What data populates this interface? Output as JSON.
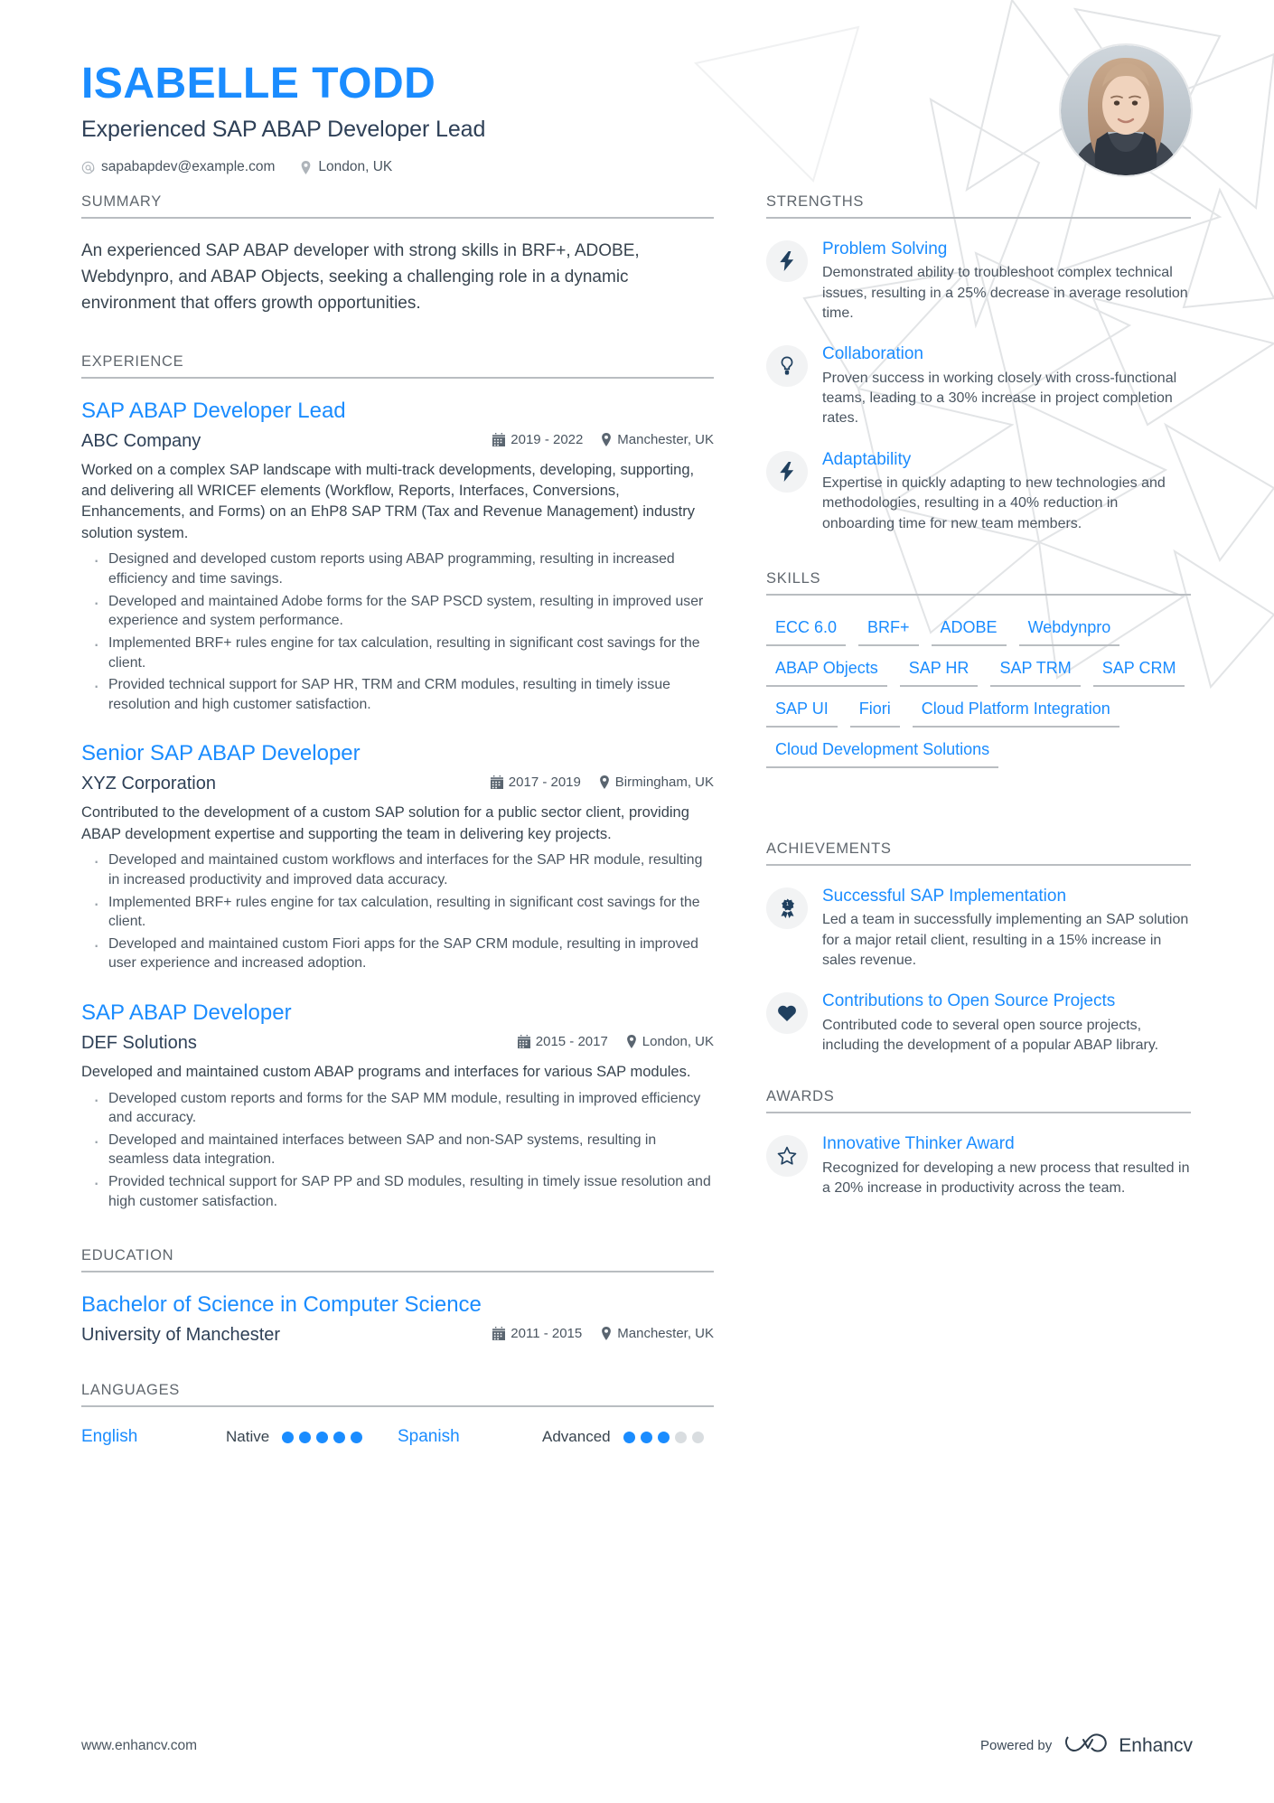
{
  "header": {
    "name": "ISABELLE TODD",
    "role": "Experienced SAP ABAP Developer Lead",
    "email": "sapabapdev@example.com",
    "email_icon": "at-icon",
    "location": "London, UK",
    "location_icon": "map-pin-icon",
    "avatar_alt": "profile-photo"
  },
  "accent_color": "#1a8cff",
  "sections": {
    "summary_title": "SUMMARY",
    "experience_title": "EXPERIENCE",
    "education_title": "EDUCATION",
    "languages_title": "LANGUAGES",
    "strengths_title": "STRENGTHS",
    "skills_title": "SKILLS",
    "achievements_title": "ACHIEVEMENTS",
    "awards_title": "AWARDS"
  },
  "summary": {
    "text": "An experienced SAP ABAP developer with strong skills in BRF+, ADOBE, Webdynpro, and ABAP Objects, seeking a challenging role in a dynamic environment that offers growth opportunities."
  },
  "experience": [
    {
      "title": "SAP ABAP Developer Lead",
      "company": "ABC Company",
      "dates": "2019 - 2022",
      "location": "Manchester, UK",
      "description": "Worked on a complex SAP landscape with multi-track developments, developing, supporting, and delivering all WRICEF elements (Workflow, Reports, Interfaces, Conversions, Enhancements, and Forms) on an EhP8 SAP TRM (Tax and Revenue Management) industry solution system.",
      "bullets": [
        "Designed and developed custom reports using ABAP programming, resulting in increased efficiency and time savings.",
        "Developed and maintained Adobe forms for the SAP PSCD system, resulting in improved user experience and system performance.",
        "Implemented BRF+ rules engine for tax calculation, resulting in significant cost savings for the client.",
        "Provided technical support for SAP HR, TRM and CRM modules, resulting in timely issue resolution and high customer satisfaction."
      ]
    },
    {
      "title": "Senior SAP ABAP Developer",
      "company": "XYZ Corporation",
      "dates": "2017 - 2019",
      "location": "Birmingham, UK",
      "description": "Contributed to the development of a custom SAP solution for a public sector client, providing ABAP development expertise and supporting the team in delivering key projects.",
      "bullets": [
        "Developed and maintained custom workflows and interfaces for the SAP HR module, resulting in increased productivity and improved data accuracy.",
        "Implemented BRF+ rules engine for tax calculation, resulting in significant cost savings for the client.",
        "Developed and maintained custom Fiori apps for the SAP CRM module, resulting in improved user experience and increased adoption."
      ]
    },
    {
      "title": "SAP ABAP Developer",
      "company": "DEF Solutions",
      "dates": "2015 - 2017",
      "location": "London, UK",
      "description": "Developed and maintained custom ABAP programs and interfaces for various SAP modules.",
      "bullets": [
        "Developed custom reports and forms for the SAP MM module, resulting in improved efficiency and accuracy.",
        "Developed and maintained interfaces between SAP and non-SAP systems, resulting in seamless data integration.",
        "Provided technical support for SAP PP and SD modules, resulting in timely issue resolution and high customer satisfaction."
      ]
    }
  ],
  "education": [
    {
      "degree": "Bachelor of Science in Computer Science",
      "school": "University of Manchester",
      "dates": "2011 - 2015",
      "location": "Manchester, UK"
    }
  ],
  "languages": [
    {
      "name": "English",
      "level": "Native",
      "filled": 5,
      "total": 5
    },
    {
      "name": "Spanish",
      "level": "Advanced",
      "filled": 3,
      "total": 5
    }
  ],
  "strengths": [
    {
      "icon": "lightning-bolt-icon",
      "title": "Problem Solving",
      "text": "Demonstrated ability to troubleshoot complex technical issues, resulting in a 25% decrease in average resolution time."
    },
    {
      "icon": "lightbulb-icon",
      "title": "Collaboration",
      "text": "Proven success in working closely with cross-functional teams, leading to a 30% increase in project completion rates."
    },
    {
      "icon": "lightning-bolt-icon",
      "title": "Adaptability",
      "text": "Expertise in quickly adapting to new technologies and methodologies, resulting in a 40% reduction in onboarding time for new team members."
    }
  ],
  "skills": [
    "ECC 6.0",
    "BRF+",
    "ADOBE",
    "Webdynpro",
    "ABAP Objects",
    "SAP HR",
    "SAP TRM",
    "SAP CRM",
    "SAP UI",
    "Fiori",
    "Cloud Platform Integration",
    "Cloud Development Solutions"
  ],
  "achievements": [
    {
      "icon": "award-ribbon-icon",
      "title": "Successful SAP Implementation",
      "text": "Led a team in successfully implementing an SAP solution for a major retail client, resulting in a 15% increase in sales revenue."
    },
    {
      "icon": "heart-icon",
      "title": "Contributions to Open Source Projects",
      "text": "Contributed code to several open source projects, including the development of a popular ABAP library."
    }
  ],
  "awards": [
    {
      "icon": "star-outline-icon",
      "title": "Innovative Thinker Award",
      "text": "Recognized for developing a new process that resulted in a 20% increase in productivity across the team."
    }
  ],
  "footer": {
    "url": "www.enhancv.com",
    "powered_by": "Powered by",
    "brand": "Enhancv",
    "brand_icon": "enhancv-logo-icon"
  }
}
